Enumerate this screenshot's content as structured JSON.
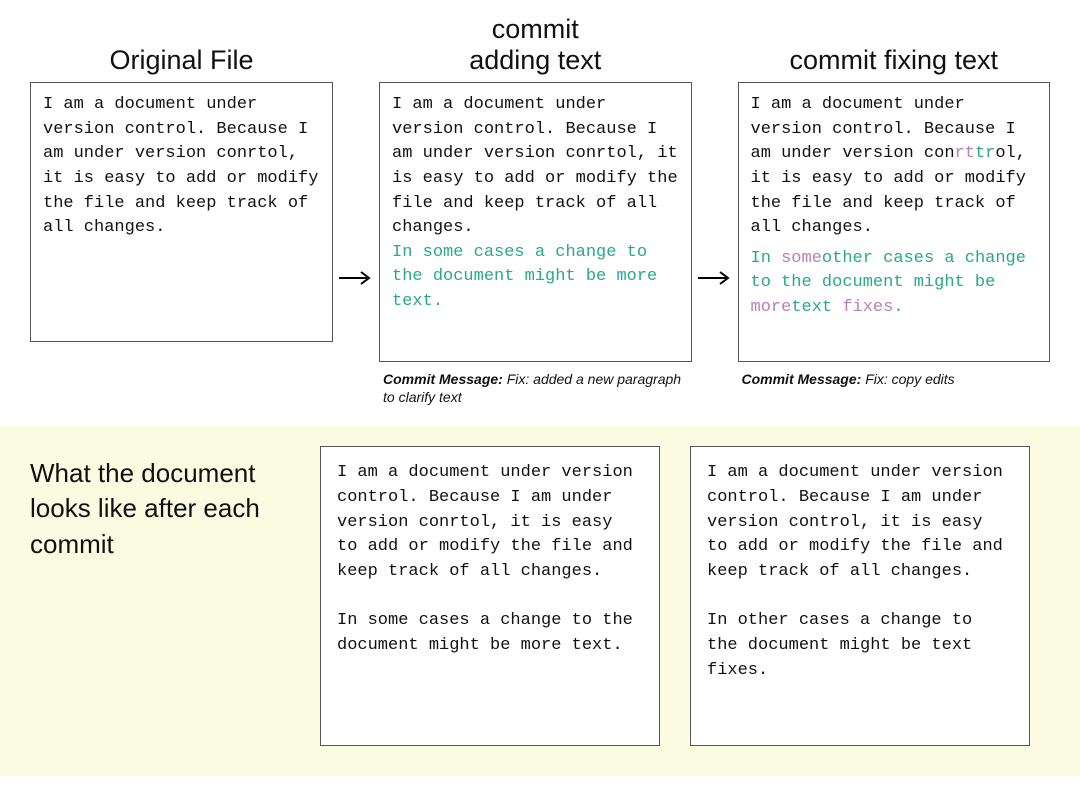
{
  "headings": {
    "original": "Original File",
    "commit1": "commit\nadding text",
    "commit2": "commit fixing text"
  },
  "original_text": "I am a document under version control. Because I am under version conrtol, it is easy to add or modify the file and keep track of all changes.",
  "commit1": {
    "base": "I am a document under version control. Because I am under version conrtol, it is easy to add or modify the file and keep track of all changes.",
    "added": "In some cases a change to the document might be more text.",
    "message_label": "Commit Message:",
    "message_text": " Fix: added a new paragraph to clarify text"
  },
  "commit2": {
    "seg1": "I am a document under version control. Because I am under version con",
    "del1": "rt",
    "add1": "tr",
    "seg2": "ol, it is easy to add or modify the file and keep track of all changes.",
    "p2a": "In ",
    "p2del1": "some",
    "p2add1": "other",
    "p2b": " cases a change to the document might be ",
    "p2del2": "more",
    "p2c": "text ",
    "p2add2": "fixes",
    "p2d": ".",
    "message_label": "Commit Message:",
    "message_text": " Fix: copy edits"
  },
  "bottom": {
    "label": "What the document looks like after each commit",
    "result1": "I am a document under version control. Because I am under version conrtol, it is easy to add or modify the file and keep track of all changes.\n\nIn some cases a change to the document might be more text.",
    "result2": "I am a document under version control. Because I am under version control, it is easy to add or modify the file and keep track of all changes.\n\nIn other cases a change to the document might be text fixes."
  }
}
